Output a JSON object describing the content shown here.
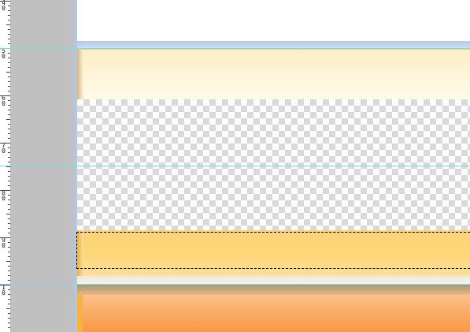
{
  "ruler": {
    "labels": [
      {
        "text": "4\n0"
      },
      {
        "text": "5\n0"
      },
      {
        "text": "6\n0"
      },
      {
        "text": "7\n0"
      },
      {
        "text": "8\n0"
      },
      {
        "text": "9\n0"
      },
      {
        "text": "1\n0"
      }
    ]
  },
  "colors": {
    "pasteboard": "#c0c0c0",
    "guide": "#6fe3e3",
    "checker": "#d9d9d9",
    "cream_layer": "#fdeec7",
    "yellow_layer": "#fdd27a",
    "orange_layer": "#faa75e"
  }
}
